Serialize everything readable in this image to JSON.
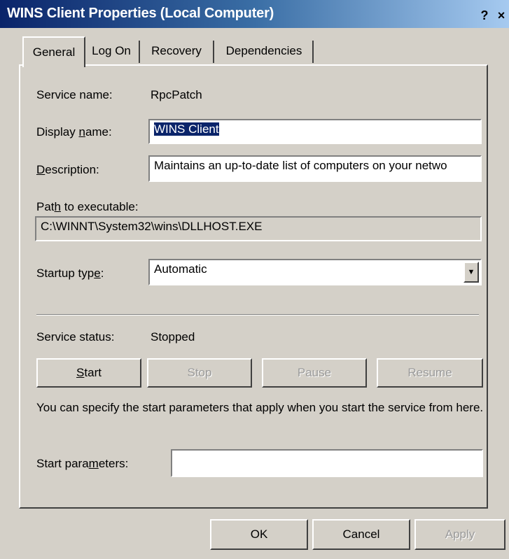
{
  "window": {
    "title": "WINS Client Properties (Local Computer)",
    "help_label": "?",
    "close_label": "×"
  },
  "tabs": [
    {
      "label": "General",
      "active": true
    },
    {
      "label": "Log On",
      "active": false
    },
    {
      "label": "Recovery",
      "active": false
    },
    {
      "label": "Dependencies",
      "active": false
    }
  ],
  "general": {
    "service_name_label": "Service name:",
    "service_name_value": "RpcPatch",
    "display_name_label_pre": "Display ",
    "display_name_label_u": "n",
    "display_name_label_post": "ame:",
    "display_name_value": "WINS Client",
    "description_label_u": "D",
    "description_label_post": "escription:",
    "description_value": "Maintains an up-to-date list of computers on your netwo",
    "path_label_pre": "Pat",
    "path_label_u": "h",
    "path_label_post": " to executable:",
    "path_value": "C:\\WINNT\\System32\\wins\\DLLHOST.EXE",
    "startup_label_pre": "Startup typ",
    "startup_label_u": "e",
    "startup_label_post": ":",
    "startup_value": "Automatic",
    "status_label": "Service status:",
    "status_value": "Stopped",
    "buttons": {
      "start_u": "S",
      "start_post": "tart",
      "stop": "Stop",
      "pause": "Pause",
      "resume": "Resume"
    },
    "info_text": "You can specify the start parameters that apply when you start the service from here.",
    "params_label_pre": "Start para",
    "params_label_u": "m",
    "params_label_post": "eters:",
    "params_value": ""
  },
  "footer": {
    "ok": "OK",
    "cancel": "Cancel",
    "apply": "Apply"
  }
}
